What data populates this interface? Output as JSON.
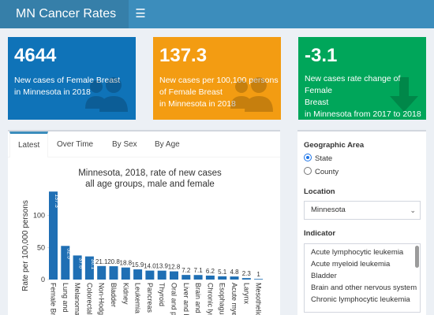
{
  "header": {
    "title": "MN Cancer Rates",
    "menu_icon": "hamburger-icon"
  },
  "value_boxes": [
    {
      "value": "4644",
      "line1": "New cases of Female Breast",
      "line2": "in Minnesota in 2018",
      "line3": "",
      "icon": "users-icon",
      "color": "#0f73b8"
    },
    {
      "value": "137.3",
      "line1": "New cases per 100,100 persons",
      "line2": "of Female Breast",
      "line3": "in Minnesota in 2018",
      "icon": "users-icon",
      "color": "#f39c12"
    },
    {
      "value": "-3.1",
      "line1": "New cases rate change of Female",
      "line2": "Breast",
      "line3": "in Minnesota from 2017 to 2018",
      "icon": "arrow-down-icon",
      "color": "#00a65a"
    }
  ],
  "tabs": [
    {
      "label": "Latest",
      "active": true
    },
    {
      "label": "Over Time",
      "active": false
    },
    {
      "label": "By Sex",
      "active": false
    },
    {
      "label": "By Age",
      "active": false
    }
  ],
  "chart_data": {
    "type": "bar",
    "title": "Minnesota, 2018, rate of new cases",
    "subtitle": "all age groups, male and female",
    "ylabel": "Rate per 100,000 persons",
    "ylim": [
      0,
      145
    ],
    "yticks": [
      0,
      50,
      100
    ],
    "bar_color": "#1f6fb4",
    "categories": [
      "Female Breast",
      "Lung and bronchus",
      "Melanoma",
      "Colorectal",
      "Non-Hodgkin",
      "Bladder",
      "Kidney",
      "Leukemia",
      "Pancreas",
      "Thyroid",
      "Oral and pharynx",
      "Liver and bile",
      "Brain and other",
      "Chronic lymphocytic",
      "Esophagus",
      "Acute myeloid",
      "Larynx",
      "Mesothelioma"
    ],
    "tick_labels": [
      "Female Breas",
      "Lung and",
      "Melanoma",
      "Colorectal",
      "Non-Hodgki",
      "Bladder",
      "Kidney",
      "Leukemia",
      "Pancreas",
      "Thyroid",
      "Oral and ph",
      "Liver and bi",
      "Brain and o",
      "Chronic lym",
      "Esophagus",
      "Acute myelo",
      "Larynx",
      "Mesothelion"
    ],
    "values": [
      137.3,
      52.5,
      37.6,
      36.1,
      21.1,
      20.8,
      18.8,
      15.9,
      14.0,
      13.9,
      12.8,
      7.2,
      7.1,
      6.2,
      5.1,
      4.8,
      2.3,
      1
    ],
    "labels": [
      "137.3",
      "52.5",
      "37.6",
      "36.1",
      "21.1",
      "20.8",
      "18.8",
      "15.9",
      "14.0",
      "13.9",
      "12.8",
      "7.2",
      "7.1",
      "6.2",
      "5.1",
      "4.8",
      "2.3",
      "1"
    ]
  },
  "side_panel": {
    "geo_label": "Geographic Area",
    "geo_options": [
      {
        "label": "State",
        "checked": true
      },
      {
        "label": "County",
        "checked": false
      }
    ],
    "location_label": "Location",
    "location_value": "Minnesota",
    "indicator_label": "Indicator",
    "indicator_options": [
      "Acute lymphocytic leukemia",
      "Acute myeloid leukemia",
      "Bladder",
      "Brain and other nervous system",
      "Chronic lymphocytic leukemia"
    ]
  }
}
